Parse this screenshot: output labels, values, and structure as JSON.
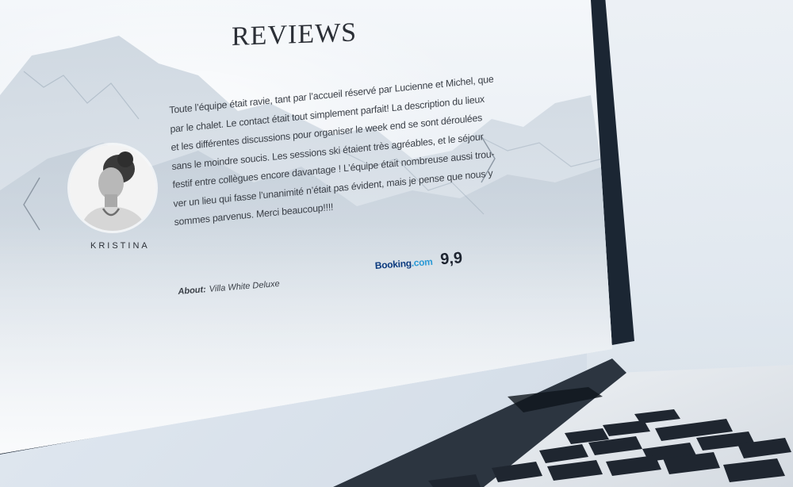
{
  "page": {
    "title": "REVIEWS"
  },
  "review": {
    "reviewer_name": "KRISTINA",
    "text_lines": [
      "Toute l’équipe était ravie, tant par l’accueil réservé par Lucienne et Michel, que",
      "par le chalet. Le contact était tout simplement parfait! La description du lieux",
      "et les différentes discussions pour organiser le week end se sont déroulées",
      "sans le moindre soucis. Les sessions ski étaient très agréables, et le séjour",
      "festif entre collègues encore davantage ! L’équipe était nombreuse aussi trou-",
      "ver un lieu qui fasse l’unanimité n’était pas évident, mais je pense que nous y",
      "sommes parvenus. Merci beaucoup!!!!"
    ],
    "about_label": "About:",
    "about_value": "Villa White Deluxe",
    "source_logo_main": "Booking",
    "source_logo_suffix": ".com",
    "score": "9,9"
  },
  "navigation": {
    "prev_icon": "chevron-left-icon",
    "next_icon": "chevron-right-icon"
  },
  "colors": {
    "bezel": "#1b2633",
    "title": "#2b2f36",
    "booking_blue": "#0b3a7e",
    "booking_light_blue": "#2a9ad6"
  }
}
